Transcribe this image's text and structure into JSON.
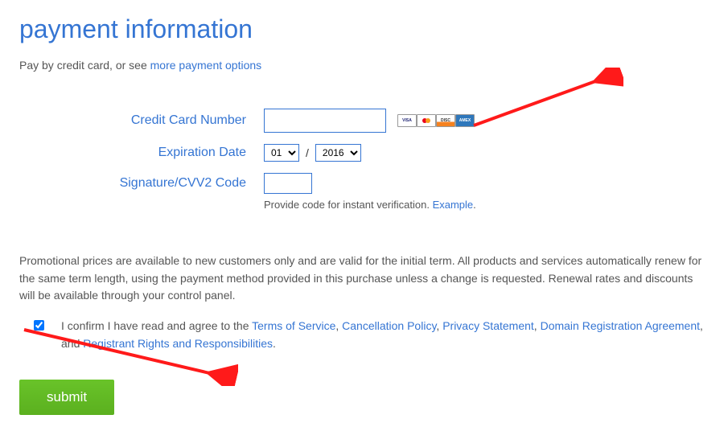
{
  "heading": "payment information",
  "intro_prefix": "Pay by credit card, or see ",
  "intro_link": "more payment options",
  "labels": {
    "cc": "Credit Card Number",
    "exp": "Expiration Date",
    "cvv": "Signature/CVV2 Code"
  },
  "fields": {
    "cc_value": "",
    "exp_month": "01",
    "exp_year": "2016",
    "cvv_value": ""
  },
  "card_icons": [
    "visa",
    "mastercard",
    "discover",
    "amex"
  ],
  "hint_text": "Provide code for instant verification. ",
  "hint_link": "Example",
  "hint_period": ".",
  "promo_text": "Promotional prices are available to new customers only and are valid for the initial term. All products and services automatically renew for the same term length, using the payment method provided in this purchase unless a change is requested. Renewal rates and discounts will be available through your control panel.",
  "agree": {
    "checked": true,
    "prefix": "I confirm I have read and agree to the ",
    "links": {
      "tos": "Terms of Service",
      "cancel": "Cancellation Policy",
      "privacy": "Privacy Statement",
      "domain": "Domain Registration Agreement",
      "registrant": "Registrant Rights and Responsibilities"
    },
    "sep": ", ",
    "and": ", and ",
    "period": "."
  },
  "submit_label": "submit"
}
